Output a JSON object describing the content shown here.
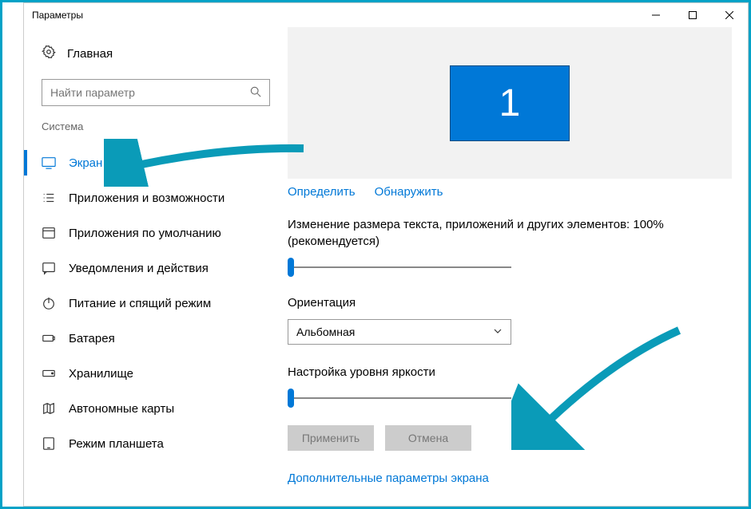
{
  "window": {
    "title": "Параметры"
  },
  "sidebar": {
    "home_label": "Главная",
    "search_placeholder": "Найти параметр",
    "section": "Система",
    "items": [
      {
        "label": "Экран"
      },
      {
        "label": "Приложения и возможности"
      },
      {
        "label": "Приложения по умолчанию"
      },
      {
        "label": "Уведомления и действия"
      },
      {
        "label": "Питание и спящий режим"
      },
      {
        "label": "Батарея"
      },
      {
        "label": "Хранилище"
      },
      {
        "label": "Автономные карты"
      },
      {
        "label": "Режим планшета"
      }
    ]
  },
  "main": {
    "monitor_number": "1",
    "identify": "Определить",
    "detect": "Обнаружить",
    "scale_label": "Изменение размера текста, приложений и других элементов: 100% (рекомендуется)",
    "orientation_label": "Ориентация",
    "orientation_value": "Альбомная",
    "brightness_label": "Настройка уровня яркости",
    "apply": "Применить",
    "cancel": "Отмена",
    "advanced": "Дополнительные параметры экрана"
  }
}
